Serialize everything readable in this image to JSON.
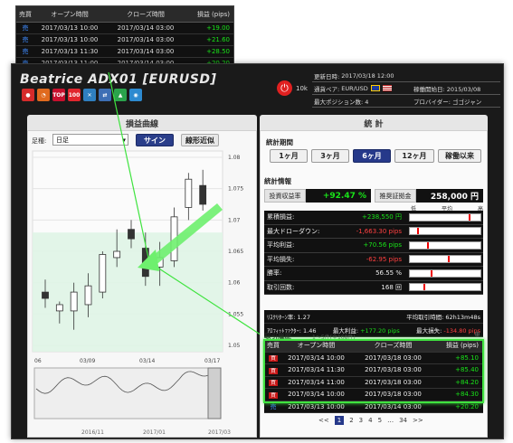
{
  "popup": {
    "headers": [
      "売買",
      "オープン時間",
      "クローズ時間",
      "損益 (pips)"
    ],
    "rows": [
      {
        "side": "売",
        "open": "2017/03/13 10:00",
        "close": "2017/03/14 03:00",
        "pips": "+19.00"
      },
      {
        "side": "売",
        "open": "2017/03/13 10:00",
        "close": "2017/03/14 03:00",
        "pips": "+21.60"
      },
      {
        "side": "売",
        "open": "2017/03/13 11:30",
        "close": "2017/03/14 03:00",
        "pips": "+28.50"
      },
      {
        "side": "売",
        "open": "2017/03/13 11:00",
        "close": "2017/03/14 03:00",
        "pips": "+20.20"
      }
    ]
  },
  "strategy": {
    "title": "Beatrice ADX01 [EURUSD]",
    "followers": "10k",
    "badges": [
      {
        "name": "mushroom-icon",
        "text": "",
        "color": "#d62b2b"
      },
      {
        "name": "gauge-icon",
        "text": "",
        "color": "#e06a1e"
      },
      {
        "name": "top100-badge-icon",
        "text": "TOP",
        "color": "#c8102e"
      },
      {
        "name": "100-badge-icon",
        "text": "100",
        "color": "#e1262e"
      },
      {
        "name": "crossed-swords-icon",
        "text": "",
        "color": "#2f7fc0"
      },
      {
        "name": "arrows-icon",
        "text": "",
        "color": "#3d6fb5"
      },
      {
        "name": "up-triangle-icon",
        "text": "",
        "color": "#2aa34c"
      },
      {
        "name": "globe-icon",
        "text": "",
        "color": "#2d8ad0"
      }
    ]
  },
  "info": {
    "updated_label": "更新日時:",
    "updated_value": "2017/03/18 12:00",
    "pair_label": "通貨ペア:",
    "pair_value": "EUR/USD",
    "start_label": "稼働開始日:",
    "start_value": "2015/03/08",
    "maxpos_label": "最大ポジション数:",
    "maxpos_value": "4",
    "provider_label": "プロバイダー:",
    "provider_value": "ゴゴジャン"
  },
  "chart_panel": {
    "tab": "損益曲線",
    "setting_label": "足種:",
    "setting_value": "日足",
    "sign_button": "サイン",
    "approx_button": "線形近似",
    "y_ticks": [
      "1.08",
      "1.075",
      "1.07",
      "1.065",
      "1.06",
      "1.055",
      "1.05"
    ],
    "x_ticks": [
      "06",
      "03/09",
      "03/14",
      "03/17"
    ],
    "mini_labels": [
      "2016/11",
      "2017/01",
      "2017/03"
    ]
  },
  "chart_data": {
    "type": "candlestick",
    "ylim": [
      1.049,
      1.081
    ],
    "x_labels": [
      "06",
      "03/09",
      "03/14",
      "03/17"
    ],
    "candles": [
      {
        "o": 1.0585,
        "h": 1.0605,
        "l": 1.056,
        "c": 1.0575
      },
      {
        "o": 1.0555,
        "h": 1.057,
        "l": 1.0535,
        "c": 1.0565
      },
      {
        "o": 1.0555,
        "h": 1.06,
        "l": 1.0525,
        "c": 1.0585
      },
      {
        "o": 1.0565,
        "h": 1.0615,
        "l": 1.0545,
        "c": 1.0595
      },
      {
        "o": 1.0585,
        "h": 1.065,
        "l": 1.0575,
        "c": 1.0645
      },
      {
        "o": 1.064,
        "h": 1.0685,
        "l": 1.0625,
        "c": 1.065
      },
      {
        "o": 1.0685,
        "h": 1.07,
        "l": 1.0655,
        "c": 1.067
      },
      {
        "o": 1.0655,
        "h": 1.068,
        "l": 1.0595,
        "c": 1.061
      },
      {
        "o": 1.0625,
        "h": 1.0665,
        "l": 1.0595,
        "c": 1.064
      },
      {
        "o": 1.0635,
        "h": 1.072,
        "l": 1.0625,
        "c": 1.0705
      },
      {
        "o": 1.072,
        "h": 1.0775,
        "l": 1.07,
        "c": 1.0765
      },
      {
        "o": 1.0755,
        "h": 1.078,
        "l": 1.0715,
        "c": 1.0725
      }
    ]
  },
  "stats_panel": {
    "tab": "統 計",
    "period_label": "統計期間",
    "periods": [
      "1ヶ月",
      "3ヶ月",
      "6ヶ月",
      "12ヶ月",
      "稼働以来"
    ],
    "active_period": "6ヶ月",
    "info_label": "統計情報",
    "return_label": "投資収益率",
    "return_value": "+92.47 %",
    "capital_label": "推奨証拠金",
    "capital_value": "258,000 円",
    "bar_header_low": "低",
    "bar_header_mid": "平均",
    "bar_header_high": "高",
    "rows": [
      {
        "label": "累積損益:",
        "value": "+238,550 円",
        "mark": 0.85
      },
      {
        "label": "最大ドローダウン:",
        "value": "-1,663.30 pips",
        "mark": 0.1
      },
      {
        "label": "平均利益:",
        "value": "+70.56 pips",
        "mark": 0.25
      },
      {
        "label": "平均損失:",
        "value": "-62.95 pips",
        "mark": 0.55
      },
      {
        "label": "勝率:",
        "value": "56.55 %",
        "mark": 0.3
      },
      {
        "label": "取引回数:",
        "value": "168 回",
        "mark": 0.2
      }
    ],
    "extra": [
      {
        "l1": "ﾘｽｸﾘﾀｰﾝ率:",
        "v1": "1.27",
        "l2": "平均取引時間:",
        "v2": "62h13m48s"
      },
      {
        "l1": "ｱﾛﾌｨｯﾄﾌｧｸﾀｰ:",
        "v1": "1.46",
        "l2": "最大利益:",
        "v2": "+177.20 pips",
        "l3": "最大損失:",
        "v3": "-134.80 pips"
      }
    ],
    "history_label": "取引履歴",
    "history_count": "1～5件(全168件)",
    "history_headers": [
      "売買",
      "オープン時間",
      "クローズ時間",
      "損益 (pips)"
    ],
    "history": [
      {
        "side": "買",
        "open": "2017/03/14 10:00",
        "close": "2017/03/18 03:00",
        "pips": "+85.10"
      },
      {
        "side": "買",
        "open": "2017/03/14 11:30",
        "close": "2017/03/18 03:00",
        "pips": "+85.40"
      },
      {
        "side": "買",
        "open": "2017/03/14 11:00",
        "close": "2017/03/18 03:00",
        "pips": "+84.20"
      },
      {
        "side": "買",
        "open": "2017/03/14 10:00",
        "close": "2017/03/18 03:00",
        "pips": "+84.30"
      },
      {
        "side": "売",
        "open": "2017/03/13 10:00",
        "close": "2017/03/14 03:00",
        "pips": "+20.20"
      }
    ],
    "pager": [
      "<<",
      "1",
      "2",
      "3",
      "4",
      "5",
      "…",
      "34",
      ">>"
    ]
  },
  "colors": {
    "highlight": "#3fe33f",
    "positive": "#19e419",
    "negative": "#ff4040",
    "accent": "#26398a"
  }
}
